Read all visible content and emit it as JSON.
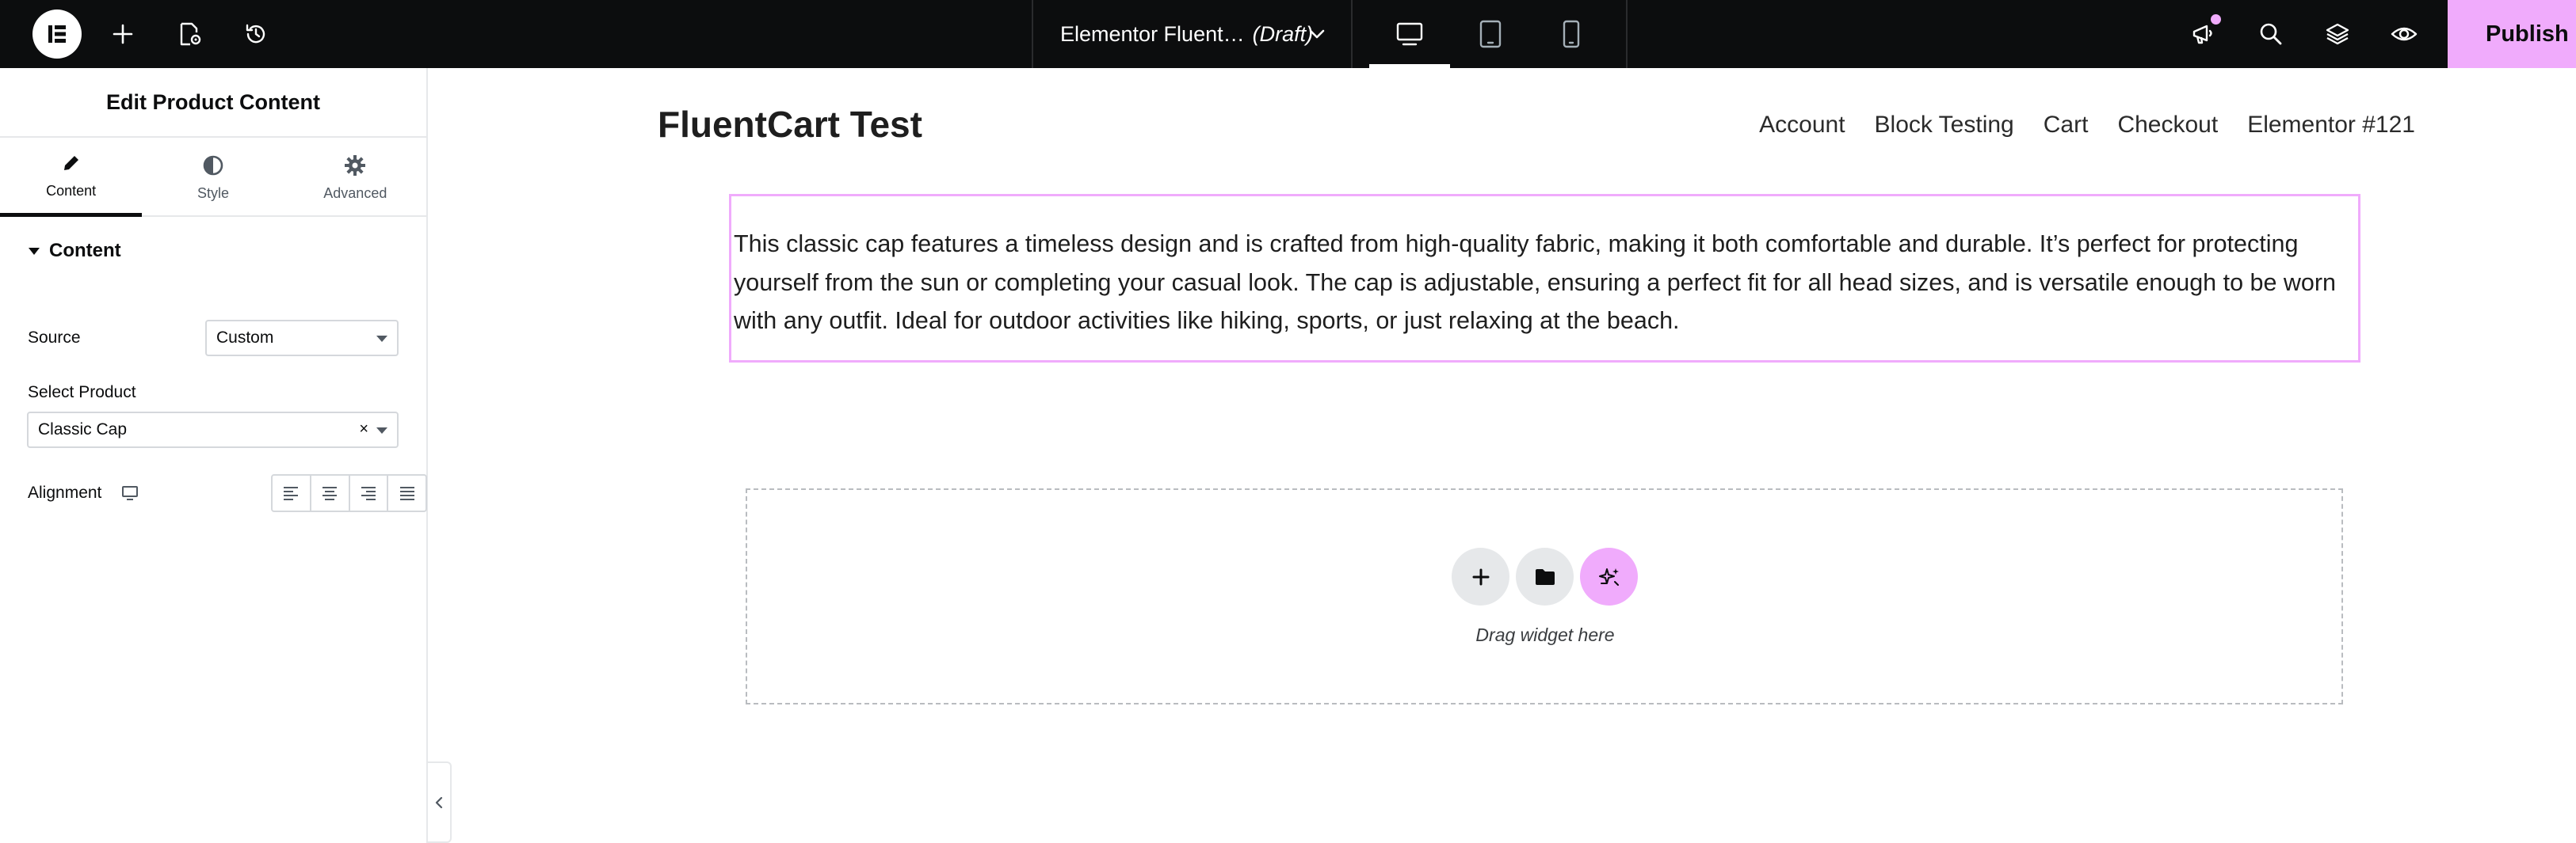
{
  "topbar": {
    "document_title": "Elementor Fluent…",
    "document_status": "(Draft)",
    "publish_label": "Publish"
  },
  "panel": {
    "title": "Edit Product Content",
    "tabs": [
      {
        "label": "Content",
        "icon": "pencil-icon",
        "active": true
      },
      {
        "label": "Style",
        "icon": "half-circle-icon",
        "active": false
      },
      {
        "label": "Advanced",
        "icon": "gear-icon",
        "active": false
      }
    ],
    "section_label": "Content",
    "source_label": "Source",
    "source_value": "Custom",
    "select_product_label": "Select Product",
    "select_product_value": "Classic Cap",
    "alignment_label": "Alignment"
  },
  "site": {
    "title": "FluentCart Test",
    "nav": [
      "Account",
      "Block Testing",
      "Cart",
      "Checkout",
      "Elementor #121"
    ]
  },
  "product": {
    "description": "This classic cap features a timeless design and is crafted from high-quality fabric, making it both comfortable and durable. It’s perfect for protecting yourself from the sun or completing your casual look. The cap is adjustable, ensuring a perfect fit for all head sizes, and is versatile enough to be worn with any outfit. Ideal for outdoor activities like hiking, sports, or just relaxing at the beach."
  },
  "dropzone": {
    "text": "Drag widget here"
  },
  "colors": {
    "topbar_bg": "#0c0d0e",
    "accent": "#f0abfc"
  }
}
